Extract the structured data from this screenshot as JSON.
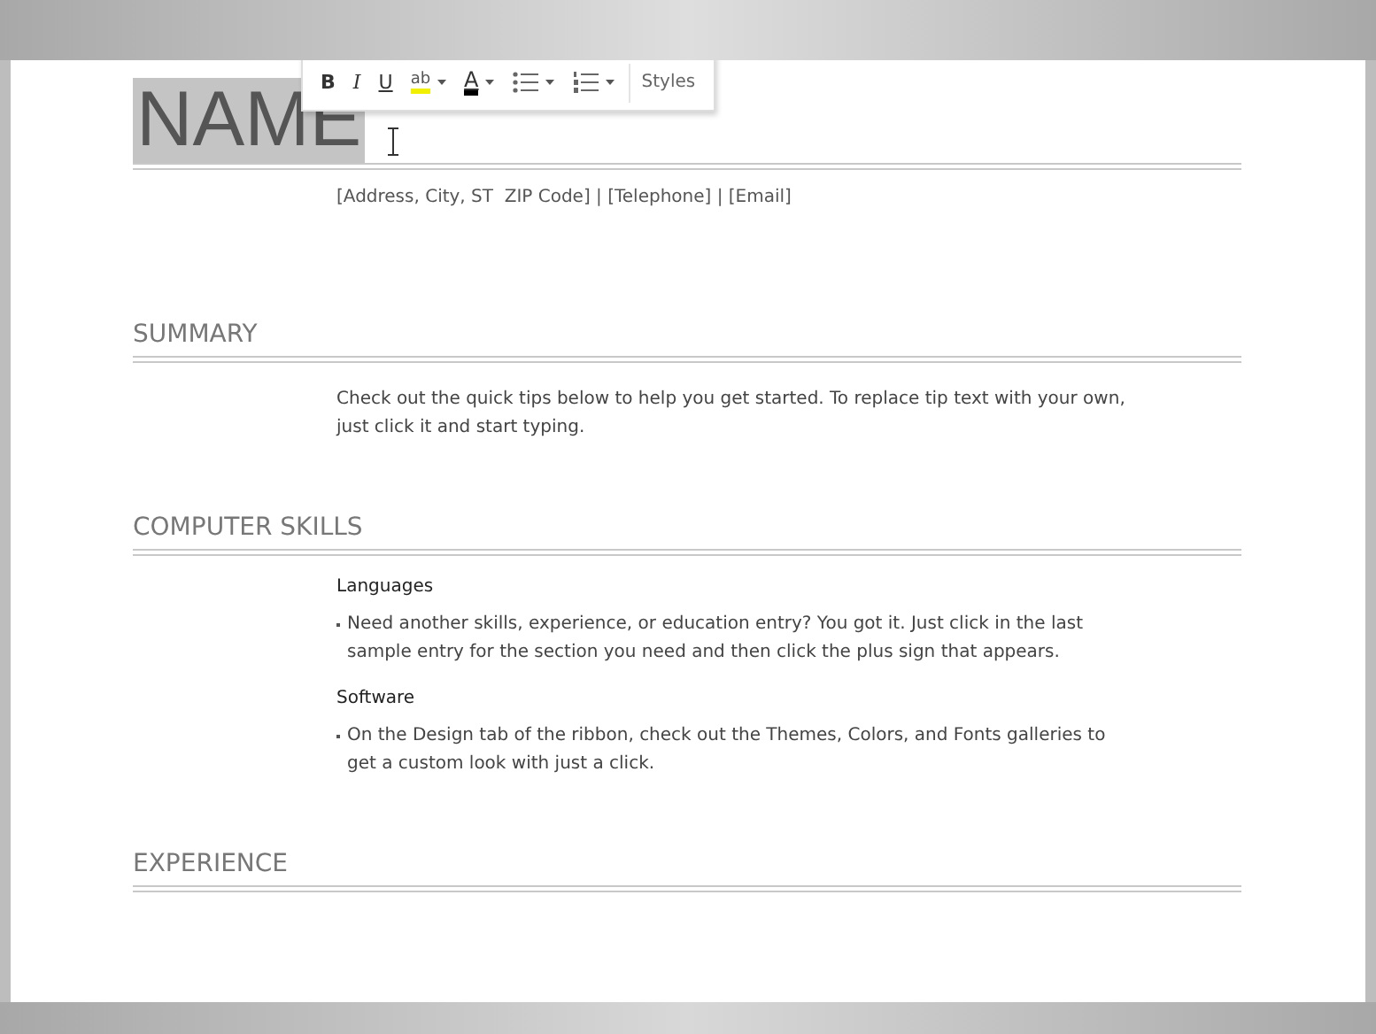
{
  "toolbar": {
    "buttons": [
      {
        "kind": "bold",
        "label": "B"
      },
      {
        "kind": "italic",
        "label": "I"
      },
      {
        "kind": "underline",
        "label": "U"
      },
      {
        "kind": "highlight",
        "label": "ab",
        "color": "#f0f000"
      },
      {
        "kind": "fontcolor",
        "label": "A",
        "color": "#000000"
      },
      {
        "kind": "bullets"
      },
      {
        "kind": "numbering"
      },
      {
        "kind": "styles",
        "label": "Styles"
      }
    ]
  },
  "name": {
    "text": "NAME",
    "selected": true
  },
  "contact": "[Address, City, ST  ZIP Code] | [Telephone] | [Email]",
  "sections": [
    {
      "heading": "SUMMARY",
      "entries": [
        {
          "kind": "paragraph",
          "text": "Check out the quick tips below to help you get started. To replace tip text with your own, just click it and start typing."
        }
      ]
    },
    {
      "heading": "COMPUTER SKILLS",
      "entries": [
        {
          "kind": "subheading",
          "text": "Languages"
        },
        {
          "kind": "bullet",
          "text": "Need another skills, experience, or education entry? You got it. Just click in the last sample entry for the section you need and then click the plus sign that appears."
        },
        {
          "kind": "subheading",
          "text": "Software"
        },
        {
          "kind": "bullet",
          "text": "On the Design tab of the ribbon, check out the Themes, Colors, and Fonts galleries to get a custom look with just a click."
        }
      ]
    },
    {
      "heading": "EXPERIENCE"
    }
  ]
}
